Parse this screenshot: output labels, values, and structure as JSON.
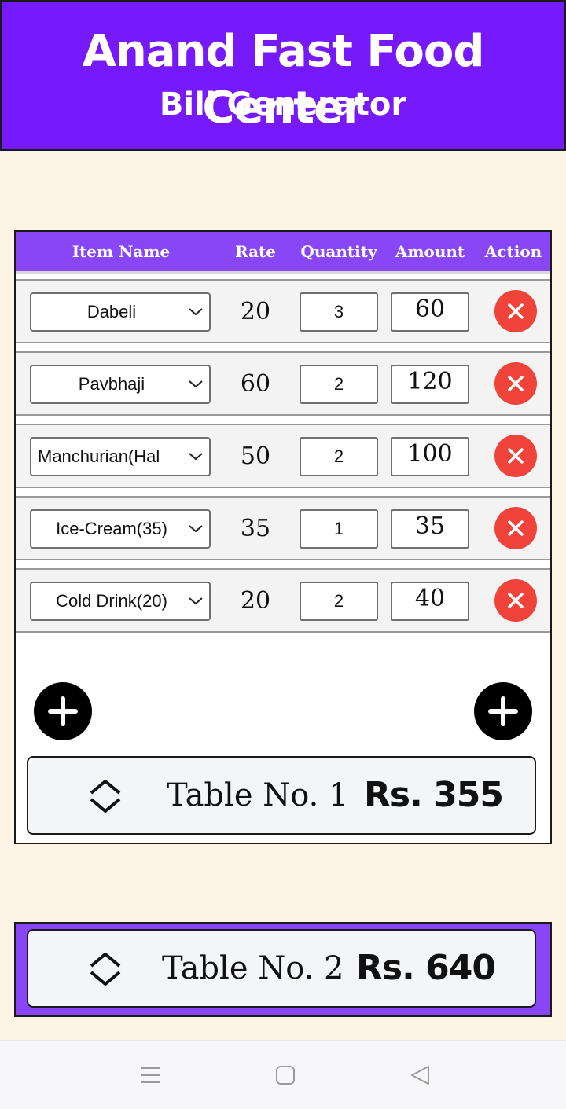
{
  "header": {
    "title": "Anand Fast Food Center",
    "subtitle": "Bill Generator"
  },
  "table_header": {
    "item_name": "Item Name",
    "rate": "Rate",
    "quantity": "Quantity",
    "amount": "Amount",
    "action": "Action"
  },
  "rows": [
    {
      "item": "Dabeli",
      "rate": "20",
      "quantity": "3",
      "amount": "60"
    },
    {
      "item": "Pavbhaji",
      "rate": "60",
      "quantity": "2",
      "amount": "120"
    },
    {
      "item": "Manchurian(Hal",
      "rate": "50",
      "quantity": "2",
      "amount": "100"
    },
    {
      "item": "Ice-Cream(35)",
      "rate": "35",
      "quantity": "1",
      "amount": "35"
    },
    {
      "item": "Cold Drink(20)",
      "rate": "20",
      "quantity": "2",
      "amount": "40"
    }
  ],
  "tables": [
    {
      "name": "Table No. 1",
      "total": "Rs. 355"
    },
    {
      "name": "Table No. 2",
      "total": "Rs. 640"
    }
  ],
  "icons": {
    "delete": "close-icon",
    "add": "plus-icon",
    "expand": "chevron-up-down-icon",
    "nav_menu": "menu-icon",
    "nav_home": "square-icon",
    "nav_back": "back-triangle-icon"
  },
  "colors": {
    "header_bg": "#7619fb",
    "table_header_bg": "#8846f7",
    "delete_red": "#f0443b",
    "page_bg": "#fcf5e6"
  }
}
